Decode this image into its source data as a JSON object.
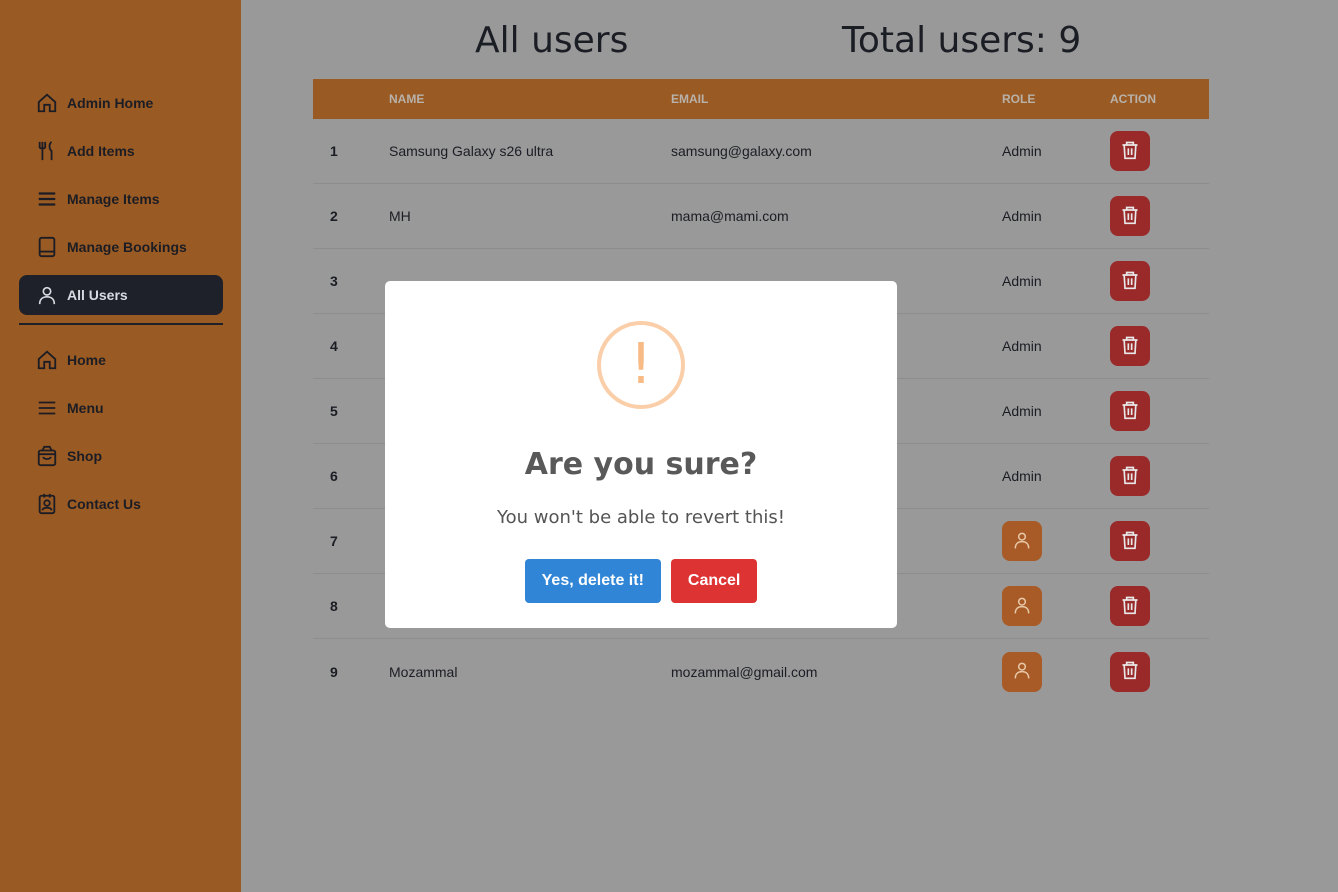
{
  "colors": {
    "sidebar_bg": "#9a5a23",
    "active_nav_bg": "#1e2129",
    "overlay_bg": "#999999",
    "delete_button": "#9a2a2a",
    "role_button": "#a85b26",
    "confirm_button": "#3085d6",
    "cancel_button": "#dd3333",
    "warning_icon": "#f8bb86"
  },
  "sidebar": {
    "admin_items": [
      {
        "label": "Admin Home",
        "icon": "home-icon"
      },
      {
        "label": "Add Items",
        "icon": "utensils-icon"
      },
      {
        "label": "Manage Items",
        "icon": "list-icon"
      },
      {
        "label": "Manage Bookings",
        "icon": "book-icon"
      },
      {
        "label": "All Users",
        "icon": "user-icon",
        "active": true
      }
    ],
    "public_items": [
      {
        "label": "Home",
        "icon": "home-icon"
      },
      {
        "label": "Menu",
        "icon": "list-icon"
      },
      {
        "label": "Shop",
        "icon": "shopping-bag-icon"
      },
      {
        "label": "Contact Us",
        "icon": "contact-card-icon"
      }
    ]
  },
  "header": {
    "title": "All users",
    "total": "Total users: 9"
  },
  "table": {
    "columns": [
      "",
      "NAME",
      "EMAIL",
      "ROLE",
      "ACTION"
    ],
    "rows": [
      {
        "index": "1",
        "name": "Samsung Galaxy s26 ultra",
        "email": "samsung@galaxy.com",
        "role": "Admin"
      },
      {
        "index": "2",
        "name": "MH",
        "email": "mama@mami.com",
        "role": "Admin"
      },
      {
        "index": "3",
        "name": "",
        "email": "",
        "role": "Admin"
      },
      {
        "index": "4",
        "name": "",
        "email": "",
        "role": "Admin"
      },
      {
        "index": "5",
        "name": "",
        "email": "",
        "role": "Admin"
      },
      {
        "index": "6",
        "name": "",
        "email": "",
        "role": "Admin"
      },
      {
        "index": "7",
        "name": "",
        "email": "",
        "role": ""
      },
      {
        "index": "8",
        "name": "",
        "email": "",
        "role": ""
      },
      {
        "index": "9",
        "name": "Mozammal",
        "email": "mozammal@gmail.com",
        "role": ""
      }
    ]
  },
  "modal": {
    "icon": "!",
    "title": "Are you sure?",
    "text": "You won't be able to revert this!",
    "confirm_label": "Yes, delete it!",
    "cancel_label": "Cancel"
  }
}
